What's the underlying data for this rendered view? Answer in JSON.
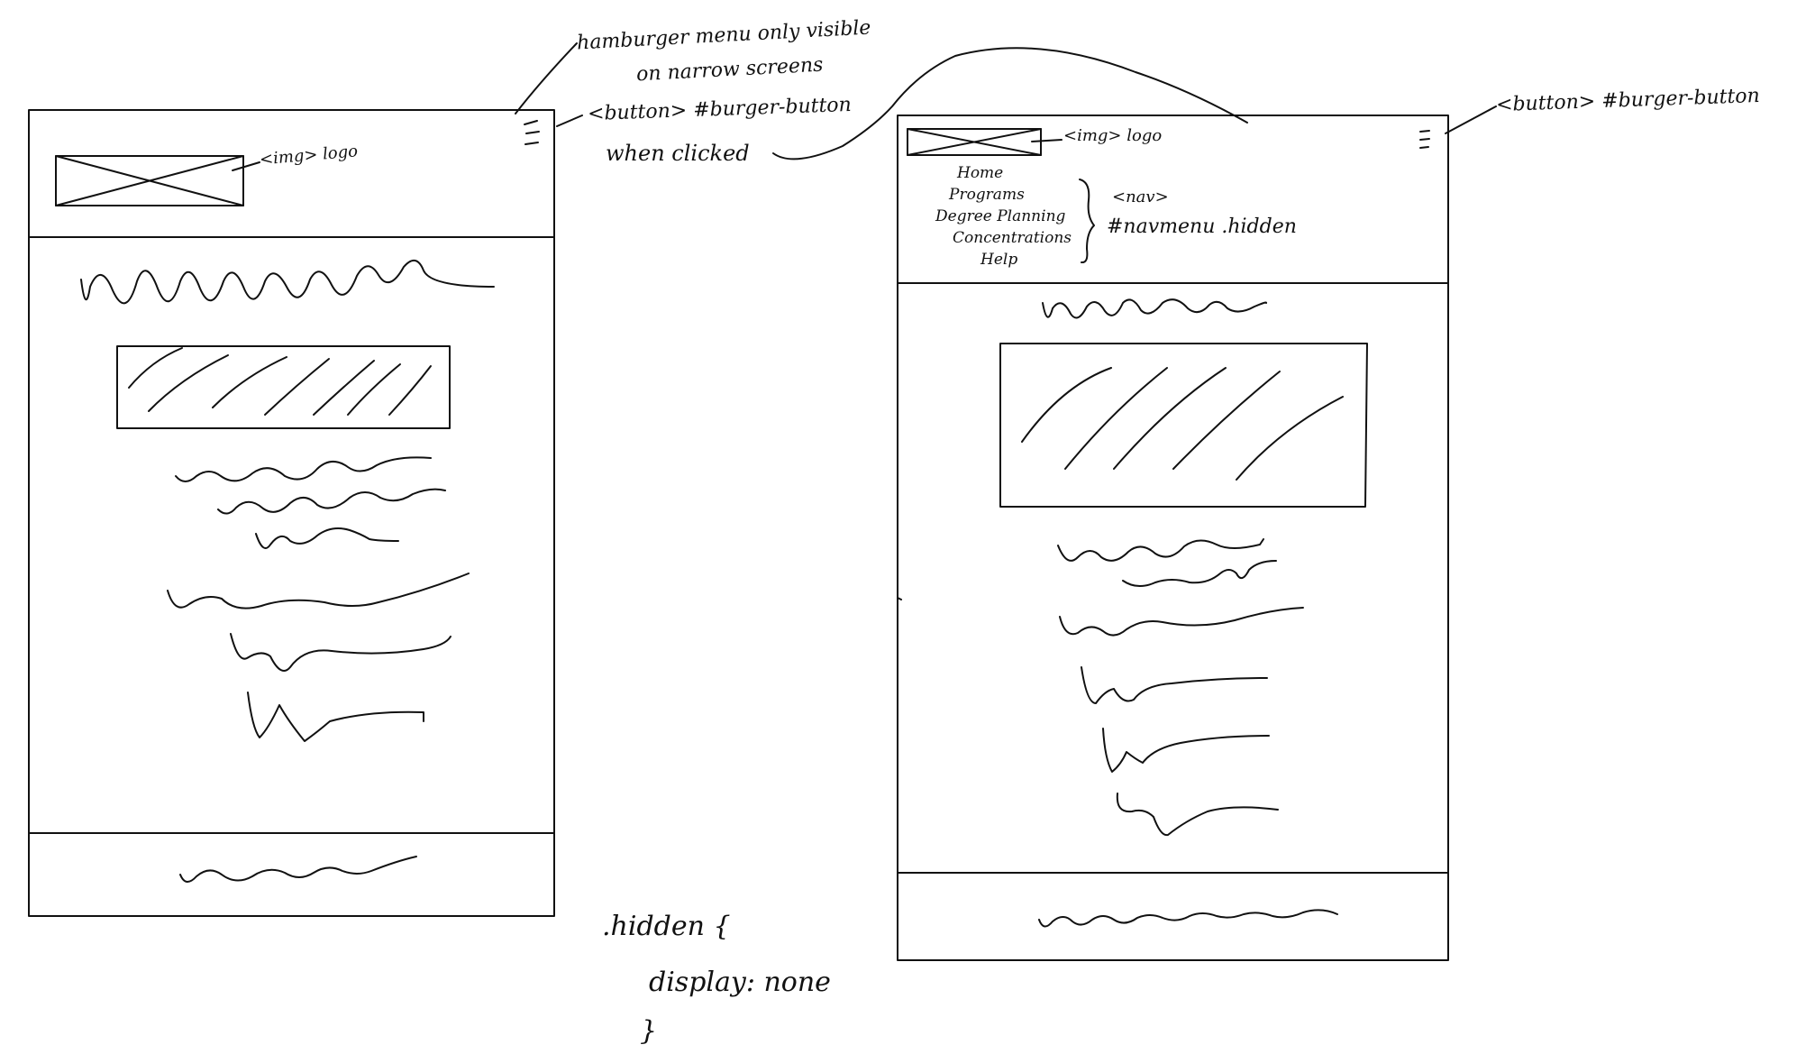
{
  "annotations": {
    "hamburger_note_line1": "hamburger menu only visible",
    "hamburger_note_line2": "on narrow screens",
    "burger_button_left": "<button> #burger-button",
    "when_clicked": "when clicked",
    "burger_button_right": "<button> #burger-button",
    "logo_left": "<img> logo",
    "logo_right": "<img> logo",
    "nav_tag": "<nav>",
    "nav_selector": "#navmenu .hidden"
  },
  "nav_menu": {
    "items": [
      "Home",
      "Programs",
      "Degree Planning",
      "Concentrations",
      "Help"
    ]
  },
  "css_snippet": {
    "line1": ".hidden {",
    "line2": "display: none",
    "line3": "}"
  },
  "colors": {
    "ink": "#111111",
    "paper": "#ffffff"
  }
}
